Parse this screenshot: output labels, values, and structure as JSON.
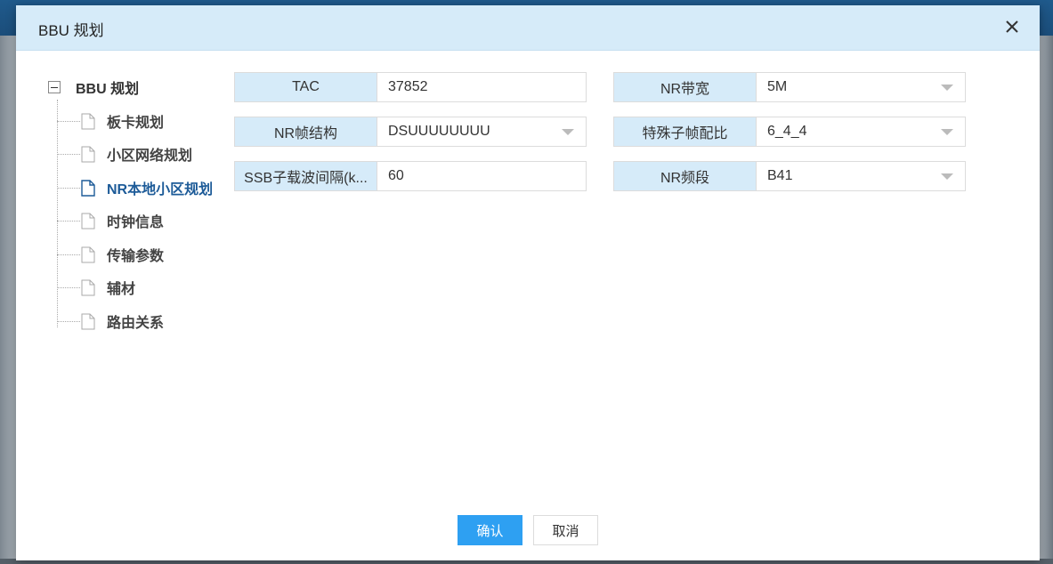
{
  "dialog": {
    "title": "BBU 规划"
  },
  "tree": {
    "root_label": "BBU 规划",
    "items": [
      {
        "label": "板卡规划"
      },
      {
        "label": "小区网络规划"
      },
      {
        "label": "NR本地小区规划",
        "active": true
      },
      {
        "label": "时钟信息"
      },
      {
        "label": "传输参数"
      },
      {
        "label": "辅材"
      },
      {
        "label": "路由关系"
      }
    ]
  },
  "form": {
    "tac": {
      "label": "TAC",
      "value": "37852"
    },
    "nr_bandwidth": {
      "label": "NR带宽",
      "value": "5M"
    },
    "nr_frame": {
      "label": "NR帧结构",
      "value": "DSUUUUUUUU"
    },
    "special_subframe": {
      "label": "特殊子帧配比",
      "value": "6_4_4"
    },
    "ssb_spacing": {
      "label": "SSB子载波间隔(k...",
      "value": "60"
    },
    "nr_band": {
      "label": "NR频段",
      "value": "B41"
    }
  },
  "footer": {
    "confirm_label": "确认",
    "cancel_label": "取消"
  },
  "colors": {
    "header_bg": "#d6ebf9",
    "label_bg": "#d6ebf9",
    "primary": "#2ea0f2",
    "active_text": "#1d5b98"
  }
}
